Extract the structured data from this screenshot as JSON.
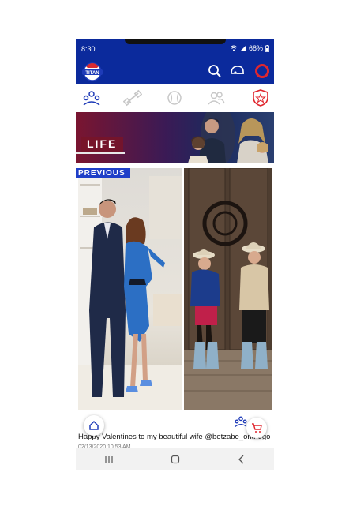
{
  "status": {
    "time": "8:30",
    "battery": "68%"
  },
  "header": {
    "logo_text": "TITAN"
  },
  "banner": {
    "title": "LIFE"
  },
  "post": {
    "badge": "PREVIOUS",
    "caption": "Happy Valentines to my beautiful wife @betzabe_onthego",
    "date": "02/13/2020 10:53 AM"
  },
  "colors": {
    "brand_blue": "#0b2a9c",
    "accent_red": "#e0262e",
    "badge_blue": "#1f3fc8"
  },
  "icons": [
    "search-icon",
    "helmet-icon",
    "profile-ring-icon",
    "community-icon",
    "fitness-icon",
    "baseball-icon",
    "friends-icon",
    "badge-star-icon",
    "home-icon",
    "cart-icon"
  ]
}
